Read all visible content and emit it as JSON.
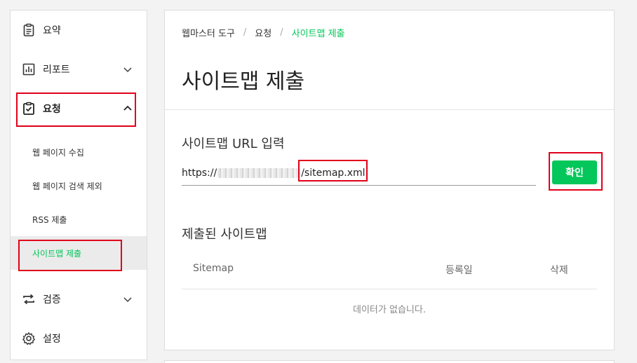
{
  "sidebar": {
    "items": [
      {
        "label": "요약",
        "icon": "clipboard-icon"
      },
      {
        "label": "리포트",
        "icon": "bar-chart-icon"
      },
      {
        "label": "요청",
        "icon": "clipboard-check-icon"
      },
      {
        "label": "검증",
        "icon": "repeat-arrows-icon"
      },
      {
        "label": "설정",
        "icon": "gear-icon"
      }
    ],
    "sub_items": [
      {
        "label": "웹 페이지 수집"
      },
      {
        "label": "웹 페이지 검색 제외"
      },
      {
        "label": "RSS 제출"
      },
      {
        "label": "사이트맵 제출"
      }
    ]
  },
  "breadcrumb": {
    "items": [
      "웹마스터 도구",
      "요청",
      "사이트맵 제출"
    ],
    "separator": "/"
  },
  "page_title": "사이트맵 제출",
  "url_section": {
    "label": "사이트맵 URL 입력",
    "url_prefix": "https://",
    "url_suffix_before": "/",
    "url_path": "sitemap.xml",
    "confirm_label": "확인"
  },
  "submitted_section": {
    "label": "제출된 사이트맵",
    "columns": [
      "Sitemap",
      "등록일",
      "삭제"
    ],
    "empty_message": "데이터가 없습니다."
  },
  "colors": {
    "accent": "#03c75a",
    "highlight_box": "#e0001a"
  }
}
